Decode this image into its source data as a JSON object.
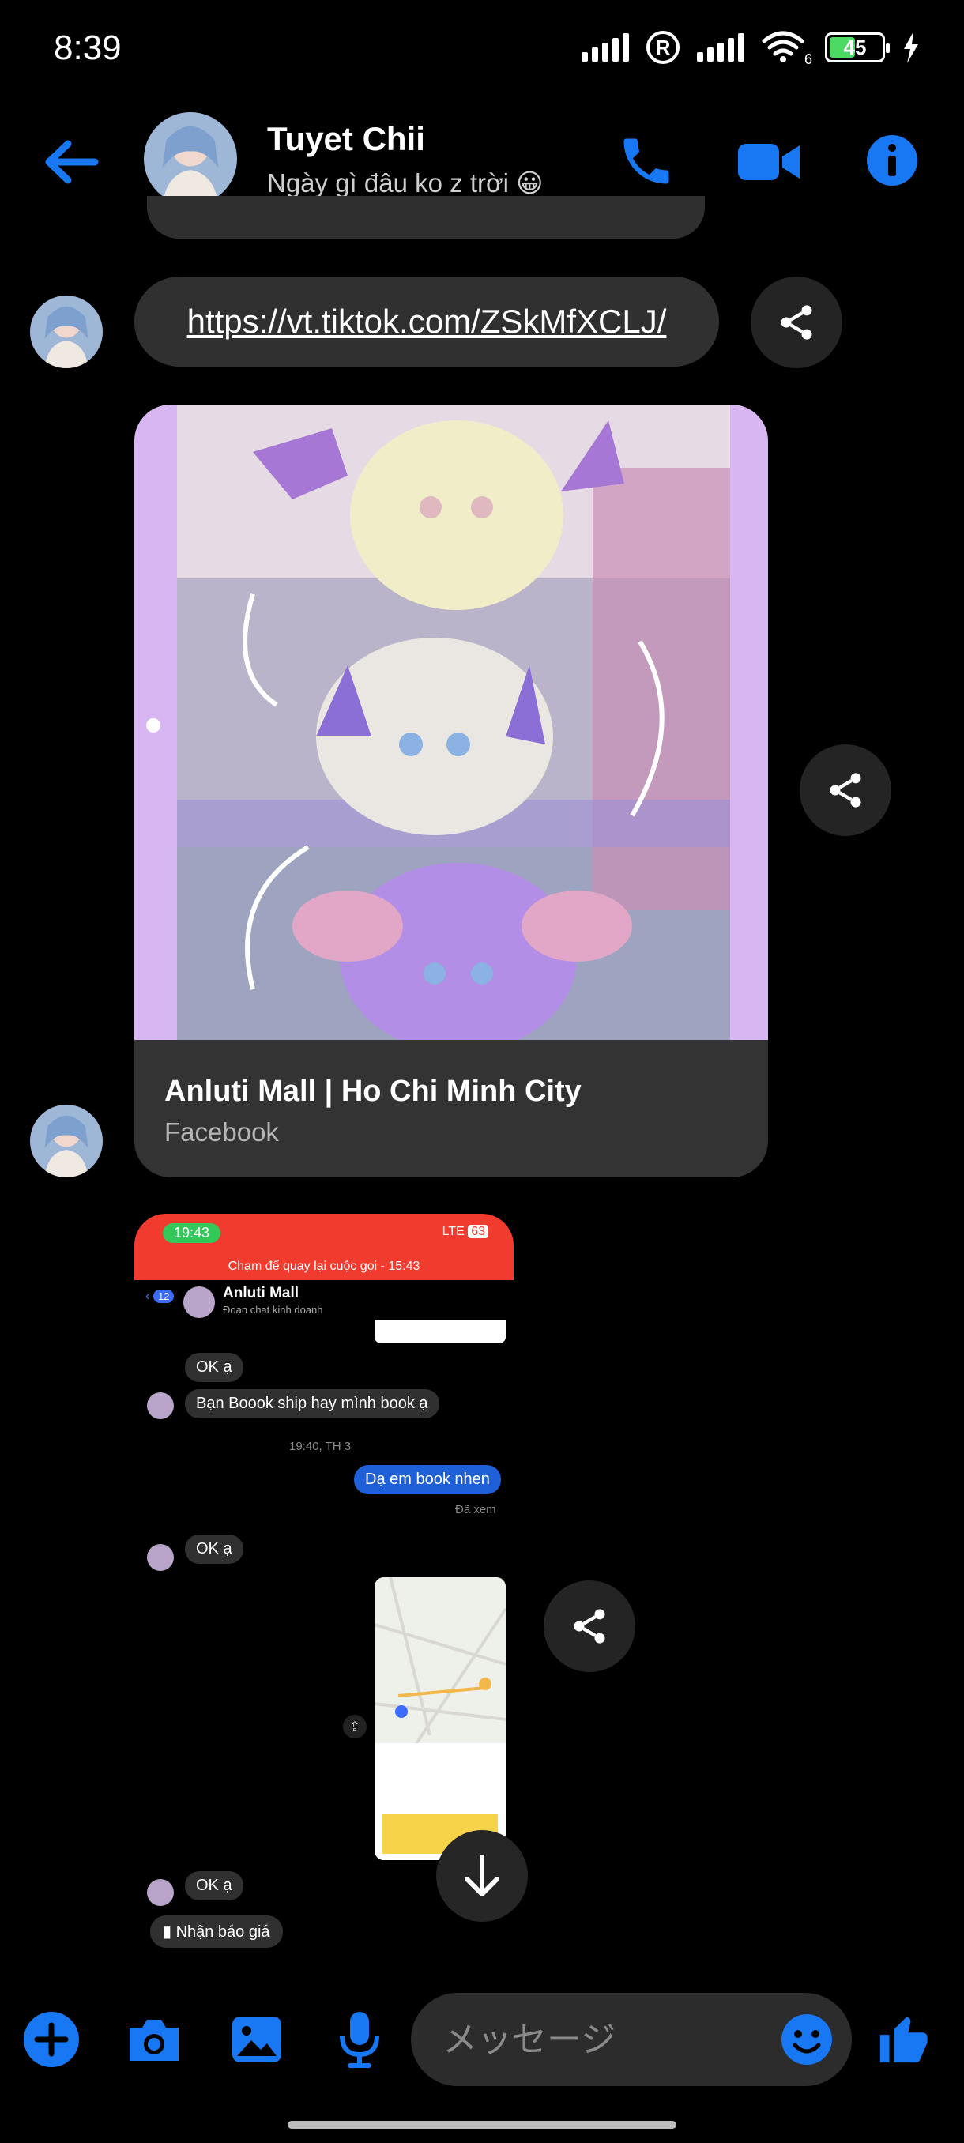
{
  "status_bar": {
    "time": "8:39",
    "network_suffix": "6",
    "battery_level": "45",
    "battery_percent": 45
  },
  "header": {
    "contact_name": "Tuyet Chii",
    "subtitle": "Ngày gì đâu ko z trời 😀",
    "accent_color": "#1877f2"
  },
  "messages": {
    "link_url": "https://vt.tiktok.com/ZSkMfXCLJ/",
    "link_card": {
      "title": "Anluti Mall | Ho Chi Minh City",
      "source": "Facebook"
    },
    "shared_screenshot": {
      "status_time": "19:43",
      "network": "LTE",
      "battery": "63",
      "recall_banner": "Chạm để quay lại cuộc gọi - 15:43",
      "back_badge": "12",
      "chat_name": "Anluti Mall",
      "chat_sub": "Đoạn chat kinh doanh",
      "bubble_ok_1": "OK ạ",
      "bubble_question": "Bạn Boook ship hay mình book ạ",
      "timestamp": "19:40, TH 3",
      "bubble_reply": "Dạ em book nhen",
      "seen": "Đã xem",
      "bubble_ok_2": "OK ạ",
      "bubble_ok_3": "OK ạ",
      "file_label": "Nhận báo giá"
    }
  },
  "composer": {
    "placeholder": "メッセージ"
  }
}
